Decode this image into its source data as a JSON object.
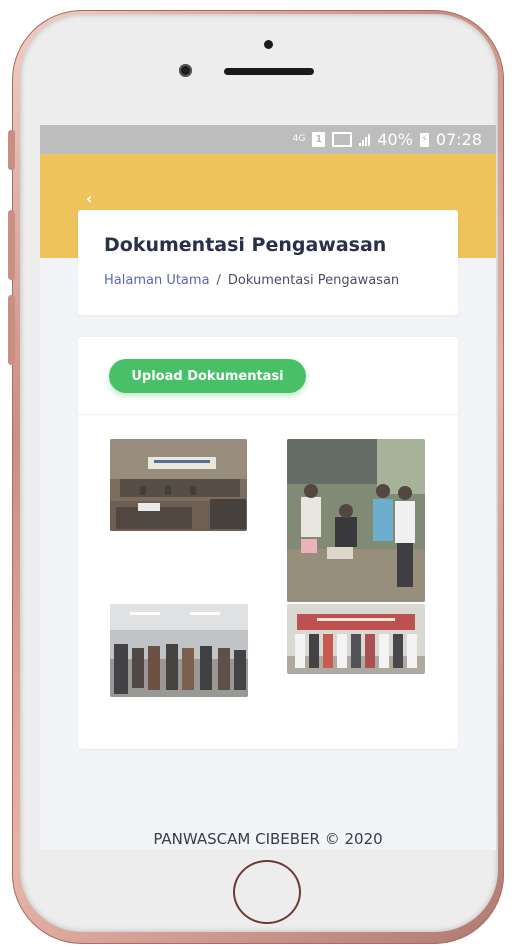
{
  "statusbar": {
    "network_label": "4G",
    "sim_label": "1",
    "battery_percent": "40%",
    "time": "07:28"
  },
  "header": {
    "back_icon": "chevron-left-icon"
  },
  "page": {
    "title": "Dokumentasi Pengawasan",
    "breadcrumb": {
      "home": "Halaman Utama",
      "separator": "/",
      "current": "Dokumentasi Pengawasan"
    }
  },
  "content": {
    "upload_button": "Upload Dokumentasi",
    "photos_count": 4
  },
  "footer": {
    "text": "PANWASCAM CIBEBER © 2020"
  },
  "colors": {
    "accent": "#efc35c",
    "button": "#47c067",
    "link": "#5a64b8",
    "title": "#28304a"
  }
}
